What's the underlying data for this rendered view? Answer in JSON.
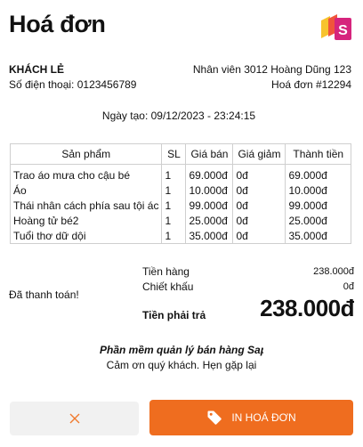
{
  "header": {
    "title": "Hoá đơn",
    "logo_icon": "sapo-logo-icon",
    "brand_colors": [
      "#f7c32e",
      "#f0553b",
      "#d6247d"
    ]
  },
  "customer": {
    "name": "KHÁCH LẺ",
    "phone": "Số điện thoại: 0123456789"
  },
  "staff": {
    "label": "Nhân viên 3012 Hoàng Dũng 123",
    "invoice": "Hoá đơn #12294"
  },
  "created": "Ngày tạo: 09/12/2023 - 23:24:15",
  "table": {
    "headers": [
      "Sản phẩm",
      "SL",
      "Giá bán",
      "Giá giảm",
      "Thành tiền"
    ],
    "rows": [
      [
        "Trao áo mưa cho cậu bé",
        "1",
        "69.000đ",
        "0đ",
        "69.000đ"
      ],
      [
        "Áo",
        "1",
        "10.000đ",
        "0đ",
        "10.000đ"
      ],
      [
        "Thái nhân cách phía sau tội ác",
        "1",
        "99.000đ",
        "0đ",
        "99.000đ"
      ],
      [
        "Hoàng tử bé2",
        "1",
        "25.000đ",
        "0đ",
        "25.000đ"
      ],
      [
        "Tuổi thơ dữ dội",
        "1",
        "35.000đ",
        "0đ",
        "35.000đ"
      ]
    ]
  },
  "summary": {
    "subtotal_label": "Tiền hàng",
    "subtotal_value": "238.000đ",
    "discount_label": "Chiết khấu",
    "discount_value": "0đ",
    "paid_label": "Đã thanh toán!",
    "total_label": "Tiền phải trả",
    "total_value": "238.000đ"
  },
  "footer": {
    "software": "Phần mềm quản lý bán hàng Sapo",
    "thanks": "Cảm ơn quý khách. Hẹn gặp lại"
  },
  "actions": {
    "cancel_icon": "close-icon",
    "print_label": "IN HOÁ ĐƠN",
    "print_icon": "tag-icon",
    "accent": "#ef6d1f"
  }
}
